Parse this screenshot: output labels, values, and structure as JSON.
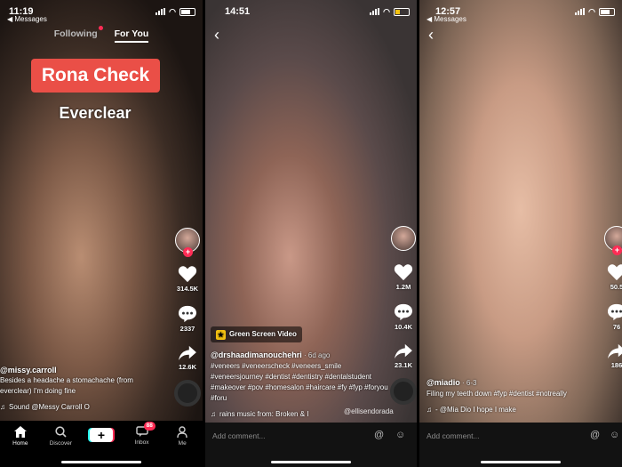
{
  "panels": [
    {
      "status_time": "11:19",
      "back_label": "Messages",
      "feed_tabs": {
        "following": "Following",
        "for_you": "For You"
      },
      "sticker": "Rona Check",
      "overlay_text": "Everclear",
      "actions": {
        "likes": "314.5K",
        "comments": "2337",
        "shares": "12.6K"
      },
      "username": "@missy.carroll",
      "caption": "Besides a headache a stomachache (from everclear) I'm doing fine",
      "music": "Sound   @Messy Carroll O",
      "nav": {
        "home": "Home",
        "discover": "Discover",
        "inbox": "Inbox",
        "inbox_badge": "88",
        "me": "Me"
      }
    },
    {
      "status_time": "14:51",
      "effect_badge": "Green Screen Video",
      "actions": {
        "likes": "1.2M",
        "comments": "10.4K",
        "shares": "23.1K"
      },
      "username": "@drshaadimanouchehri",
      "time_ago": " · 6d ago",
      "caption": "#veneers #veneerscheck #veneers_smile #veneersjourney #dentist #dentistry #dentalstudent #makeover #pov #homesalon #haircare #fy #fyp #foryou #foru",
      "music": "rains music from: Broken & I",
      "watermark": "@ellisendorada",
      "comment_placeholder": "Add comment..."
    },
    {
      "status_time": "12:57",
      "back_label": "Messages",
      "actions": {
        "likes": "50.5",
        "comments": "76",
        "shares": "186"
      },
      "username": "@miadio",
      "time_ago": " · 6-3",
      "caption": "Filing my teeth down #fyp #dentist #notreally",
      "music": "- @Mia Dio    I hope I make",
      "comment_placeholder": "Add comment..."
    }
  ]
}
